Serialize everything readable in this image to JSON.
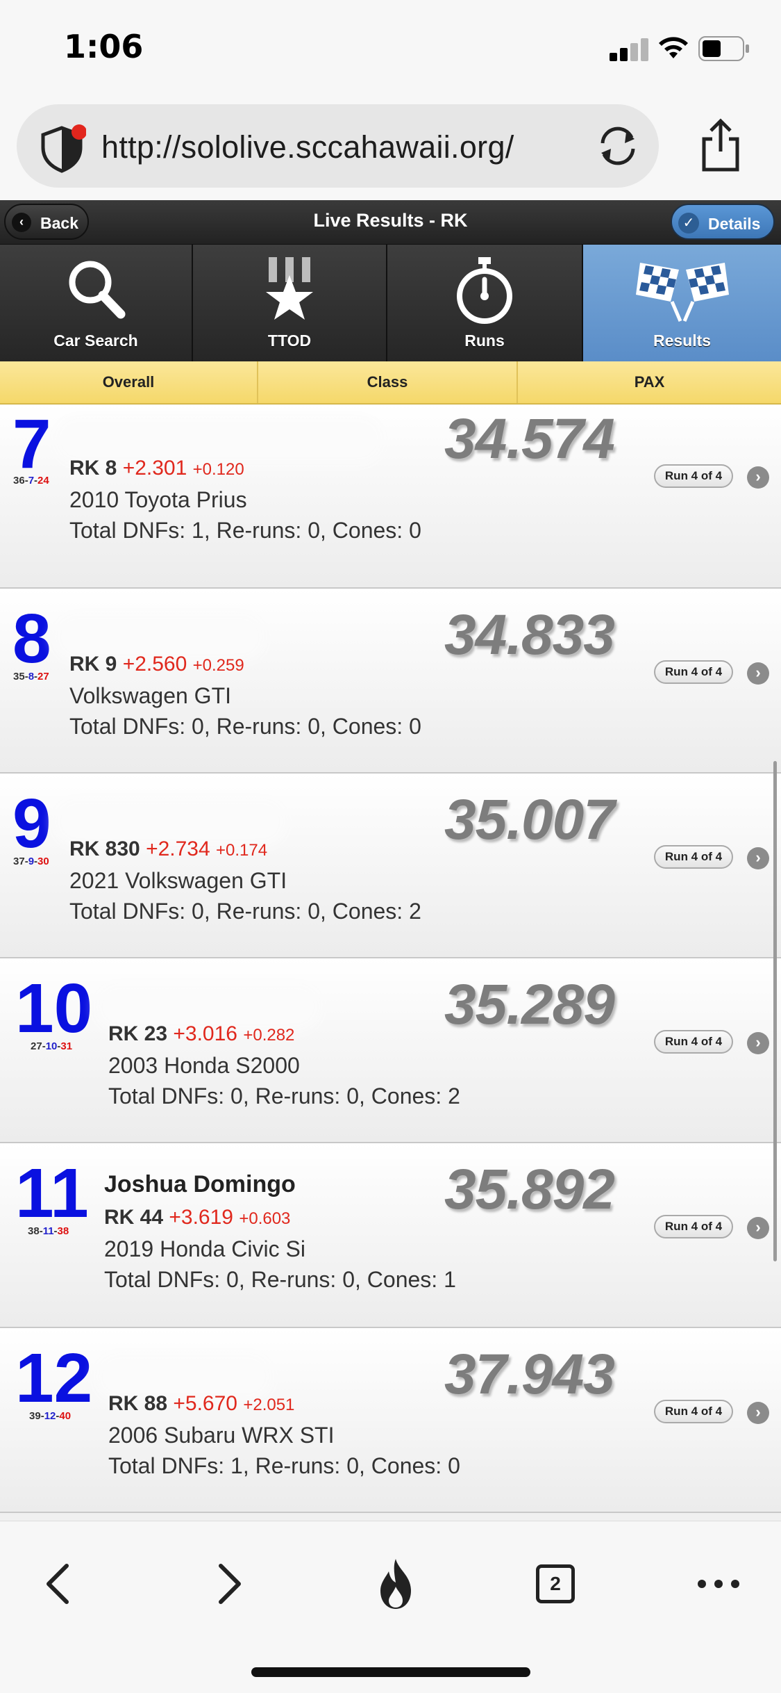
{
  "status_bar": {
    "time": "1:06"
  },
  "browser": {
    "url": "http://sololive.sccahawaii.org/",
    "tab_count": "2"
  },
  "header": {
    "back": "Back",
    "title": "Live Results - RK",
    "details": "Details"
  },
  "tabs": [
    {
      "label": "Car Search",
      "icon": "search-icon"
    },
    {
      "label": "TTOD",
      "icon": "medal-icon"
    },
    {
      "label": "Runs",
      "icon": "stopwatch-icon"
    },
    {
      "label": "Results",
      "icon": "checkered-flags-icon",
      "active": true
    }
  ],
  "segments": [
    "Overall",
    "Class",
    "PAX"
  ],
  "results": [
    {
      "pos": "7",
      "overall": "36",
      "cls": "7",
      "pax": "24",
      "name": "",
      "class_num": "RK 8",
      "diff1": "+2.301",
      "diff2": "+0.120",
      "car": "2010 Toyota Prius",
      "totals": "Total DNFs: 1, Re-runs: 0, Cones: 0",
      "time": "34.574",
      "run": "Run 4 of 4"
    },
    {
      "pos": "8",
      "overall": "35",
      "cls": "8",
      "pax": "27",
      "name": "",
      "class_num": "RK 9",
      "diff1": "+2.560",
      "diff2": "+0.259",
      "car": "Volkswagen GTI",
      "totals": "Total DNFs: 0, Re-runs: 0, Cones: 0",
      "time": "34.833",
      "run": "Run 4 of 4"
    },
    {
      "pos": "9",
      "overall": "37",
      "cls": "9",
      "pax": "30",
      "name": "",
      "class_num": "RK 830",
      "diff1": "+2.734",
      "diff2": "+0.174",
      "car": "2021 Volkswagen GTI",
      "totals": "Total DNFs: 0, Re-runs: 0, Cones: 2",
      "time": "35.007",
      "run": "Run 4 of 4"
    },
    {
      "pos": "10",
      "overall": "27",
      "cls": "10",
      "pax": "31",
      "name": "",
      "class_num": "RK 23",
      "diff1": "+3.016",
      "diff2": "+0.282",
      "car": "2003 Honda S2000",
      "totals": "Total DNFs: 0, Re-runs: 0, Cones: 2",
      "time": "35.289",
      "run": "Run 4 of 4"
    },
    {
      "pos": "11",
      "overall": "38",
      "cls": "11",
      "pax": "38",
      "name": "Joshua Domingo",
      "class_num": "RK 44",
      "diff1": "+3.619",
      "diff2": "+0.603",
      "car": "2019 Honda Civic Si",
      "totals": "Total DNFs: 0, Re-runs: 0, Cones: 1",
      "time": "35.892",
      "run": "Run 4 of 4"
    },
    {
      "pos": "12",
      "overall": "39",
      "cls": "12",
      "pax": "40",
      "name": "",
      "class_num": "RK 88",
      "diff1": "+5.670",
      "diff2": "+2.051",
      "car": "2006 Subaru WRX STI",
      "totals": "Total DNFs: 1, Re-runs: 0, Cones: 0",
      "time": "37.943",
      "run": "Run 4 of 4"
    }
  ]
}
